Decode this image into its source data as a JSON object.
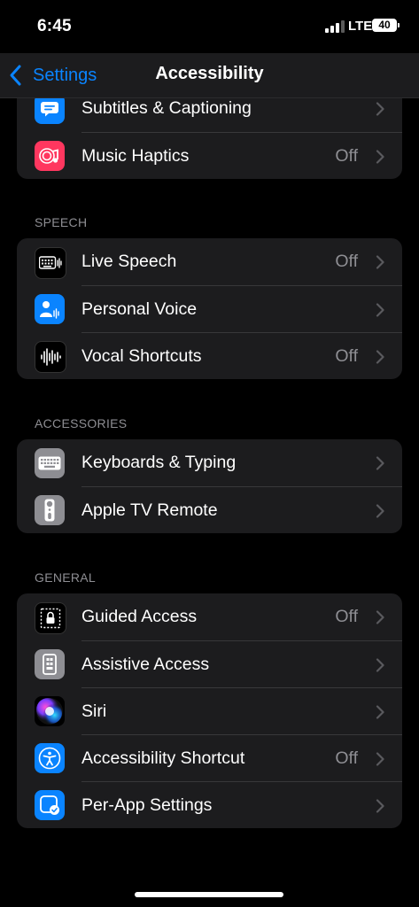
{
  "status_bar": {
    "time": "6:45",
    "network": "LTE",
    "battery": "40"
  },
  "nav": {
    "back_label": "Settings",
    "title": "Accessibility"
  },
  "sections": {
    "top": {
      "rows": [
        {
          "label": "Subtitles & Captioning",
          "value": "",
          "icon": "captions-icon",
          "icon_color": "#0a84ff"
        },
        {
          "label": "Music Haptics",
          "value": "Off",
          "icon": "music-haptics-icon",
          "icon_color": "#ff375f"
        }
      ]
    },
    "speech": {
      "header": "SPEECH",
      "rows": [
        {
          "label": "Live Speech",
          "value": "Off",
          "icon": "keyboard-waveform-icon",
          "icon_color": "#000000"
        },
        {
          "label": "Personal Voice",
          "value": "",
          "icon": "person-waveform-icon",
          "icon_color": "#0a84ff"
        },
        {
          "label": "Vocal Shortcuts",
          "value": "Off",
          "icon": "waveform-icon",
          "icon_color": "#000000"
        }
      ]
    },
    "accessories": {
      "header": "ACCESSORIES",
      "rows": [
        {
          "label": "Keyboards & Typing",
          "value": "",
          "icon": "keyboard-icon",
          "icon_color": "#8e8e93"
        },
        {
          "label": "Apple TV Remote",
          "value": "",
          "icon": "remote-icon",
          "icon_color": "#8e8e93"
        }
      ]
    },
    "general": {
      "header": "GENERAL",
      "rows": [
        {
          "label": "Guided Access",
          "value": "Off",
          "icon": "lock-icon",
          "icon_color": "#000000"
        },
        {
          "label": "Assistive Access",
          "value": "",
          "icon": "assistive-access-icon",
          "icon_color": "#8e8e93"
        },
        {
          "label": "Siri",
          "value": "",
          "icon": "siri-icon",
          "icon_color": "#000000"
        },
        {
          "label": "Accessibility Shortcut",
          "value": "Off",
          "icon": "accessibility-icon",
          "icon_color": "#0a84ff"
        },
        {
          "label": "Per-App Settings",
          "value": "",
          "icon": "per-app-icon",
          "icon_color": "#0a84ff"
        }
      ]
    }
  }
}
